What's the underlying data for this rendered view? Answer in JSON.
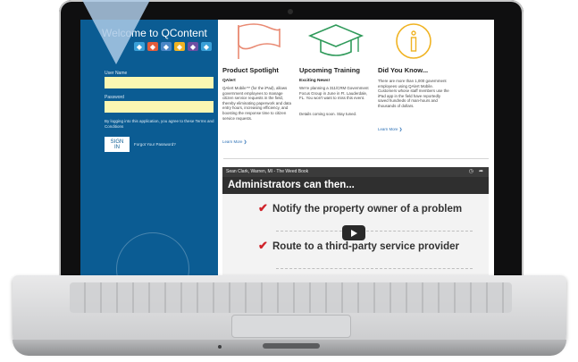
{
  "login": {
    "title": "Welcome to QContent",
    "username_label": "User Name",
    "password_label": "Password",
    "terms": "By logging into this application, you agree to these Terms and Conditions",
    "signin_label": "SIGN IN",
    "forgot_label": "Forgot Your Password?",
    "app_icons": [
      {
        "name": "app-icon-1",
        "color": "#3aa0d8"
      },
      {
        "name": "app-icon-2",
        "color": "#e35d3b"
      },
      {
        "name": "app-icon-3",
        "color": "#4b86c6"
      },
      {
        "name": "app-icon-4",
        "color": "#f0b323"
      },
      {
        "name": "app-icon-5",
        "color": "#6e4fa3"
      },
      {
        "name": "app-icon-6",
        "color": "#3aa0d8"
      }
    ]
  },
  "spotlight": {
    "title": "Product Spotlight",
    "subtitle": "QAlert",
    "body": "QAlert Mobile™ (for the iPad), allows government employees to manage citizen service requests in the field, thereby eliminating paperwork and data entry hours, increasing efficiency, and boosting the response time to citizen service requests.",
    "more": "Learn More ❯",
    "icon": "flag-icon",
    "icon_color": "#e98a73"
  },
  "training": {
    "title": "Upcoming Training",
    "subtitle": "Exciting News!",
    "body": "We're planning a 311/CRM Government Focus Group in June in Ft. Lauderdale, FL. You won't want to miss this event.",
    "body2": "Details coming soon. Stay tuned.",
    "icon": "graduation-cap-icon",
    "icon_color": "#2f9a5a"
  },
  "didyouknow": {
    "title": "Did You Know...",
    "body": "There are more than 1,000 government employees using QAlert Mobile. Customers whose staff members use the iPad app in the field have reportedly saved hundreds of man-hours and thousands of dollars.",
    "more": "Learn More ❯",
    "icon": "info-icon",
    "icon_color": "#f0b323"
  },
  "video": {
    "channel_title": "Sean Clark, Warren, MI - The Weed Book",
    "heading": "Administrators can then...",
    "bullets": [
      "Notify the property owner of a problem",
      "Route to a third-party service provider"
    ]
  }
}
